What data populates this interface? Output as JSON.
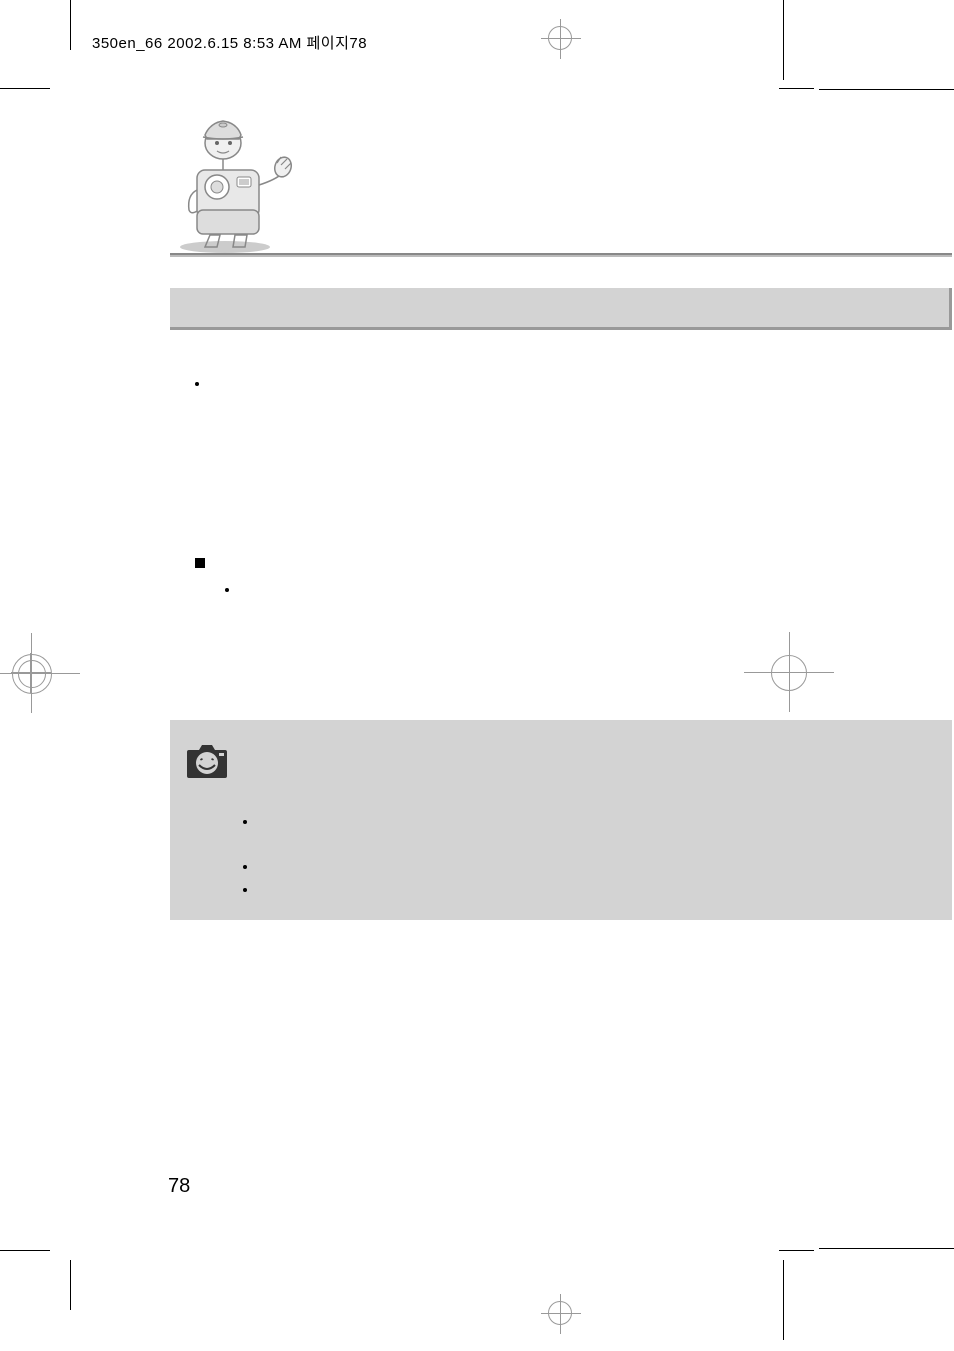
{
  "header": {
    "slug": "350en_66  2002.6.15 8:53 AM  페이지78"
  },
  "page": {
    "number": "78"
  }
}
